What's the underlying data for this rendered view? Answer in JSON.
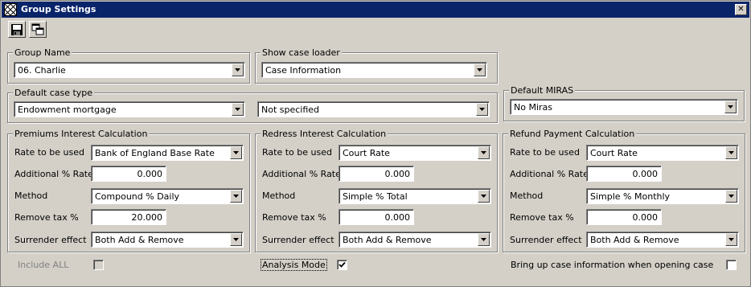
{
  "window": {
    "title": "Group Settings",
    "close_label": "✕"
  },
  "toolbar": {
    "save_icon": "save-icon",
    "copy_icon": "copy-windows-icon"
  },
  "group_name": {
    "legend": "Group Name",
    "value": "06. Charlie"
  },
  "show_case_loader": {
    "legend": "Show case loader",
    "value": "Case Information"
  },
  "default_case_type": {
    "legend": "Default case type",
    "value1": "Endowment mortgage",
    "value2": "Not specified"
  },
  "default_miras": {
    "legend": "Default MIRAS",
    "value": "No Miras"
  },
  "labels": {
    "rate": "Rate to be used",
    "additional": "Additional % Rate",
    "method": "Method",
    "remove_tax": "Remove tax %",
    "surrender": "Surrender effect"
  },
  "premiums": {
    "legend": "Premiums Interest Calculation",
    "rate": "Bank of England Base Rate",
    "additional": "0.000",
    "method": "Compound % Daily",
    "remove_tax": "20.000",
    "surrender": "Both Add & Remove"
  },
  "redress": {
    "legend": "Redress Interest Calculation",
    "rate": "Court Rate",
    "additional": "0.000",
    "method": "Simple % Total",
    "remove_tax": "0.000",
    "surrender": "Both Add & Remove"
  },
  "refund": {
    "legend": "Refund Payment Calculation",
    "rate": "Court Rate",
    "additional": "0.000",
    "method": "Simple % Monthly",
    "remove_tax": "0.000",
    "surrender": "Both Add & Remove"
  },
  "options": {
    "include_all": {
      "label": "Include ALL",
      "checked": false,
      "enabled": false
    },
    "analysis_mode": {
      "label": "Analysis Mode",
      "checked": true
    },
    "bring_up": {
      "label": "Bring up case information when opening case",
      "checked": false
    }
  }
}
